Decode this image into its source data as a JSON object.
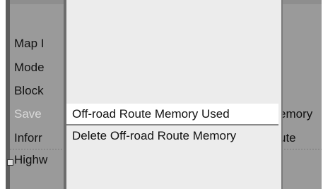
{
  "menu": {
    "items": [
      {
        "label": "Map I"
      },
      {
        "label": "Mode"
      },
      {
        "label": "Block"
      },
      {
        "label": "Save"
      },
      {
        "label": "Inforr"
      },
      {
        "label": "Highw"
      }
    ],
    "right_fragments": {
      "save_tail": "emory",
      "info_tail": "ute"
    }
  },
  "popup": {
    "items": [
      {
        "label": "Off-road Route Memory Used",
        "highlighted": true
      },
      {
        "label": "Delete Off-road Route Memory",
        "highlighted": false
      }
    ]
  }
}
